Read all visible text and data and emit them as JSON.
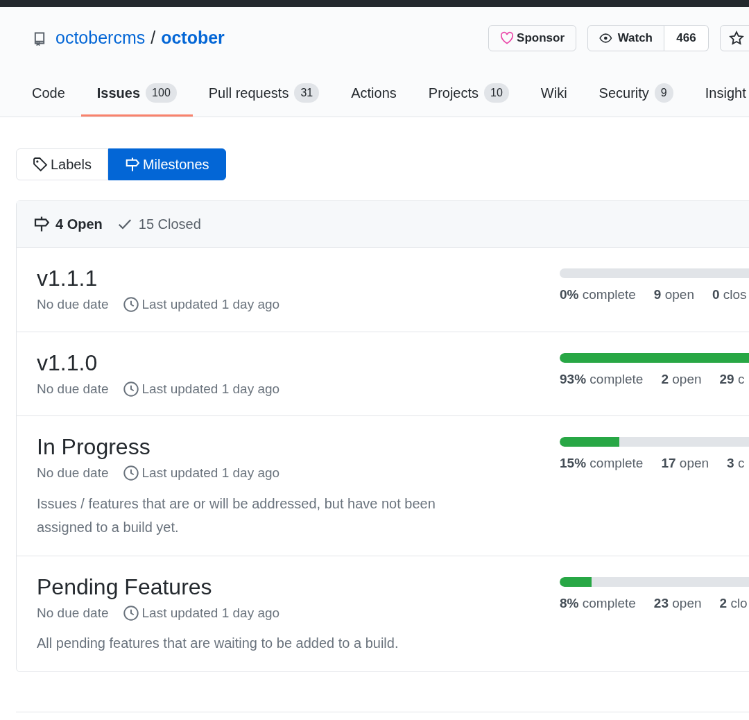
{
  "repo": {
    "owner": "octobercms",
    "separator": "/",
    "name": "october"
  },
  "header_buttons": [
    {
      "kind": "sponsor",
      "label": "Sponsor"
    },
    {
      "kind": "watch",
      "label": "Watch",
      "count": "466"
    },
    {
      "kind": "star"
    }
  ],
  "tabs": [
    {
      "label": "Code",
      "selected": false
    },
    {
      "label": "Issues",
      "count": "100",
      "selected": true
    },
    {
      "label": "Pull requests",
      "count": "31",
      "selected": false
    },
    {
      "label": "Actions",
      "selected": false
    },
    {
      "label": "Projects",
      "count": "10",
      "selected": false
    },
    {
      "label": "Wiki",
      "selected": false
    },
    {
      "label": "Security",
      "count": "9",
      "selected": false
    },
    {
      "label": "Insight",
      "selected": false
    }
  ],
  "subnav": [
    {
      "kind": "tag",
      "label": "Labels",
      "selected": false
    },
    {
      "kind": "milestone",
      "label": "Milestones",
      "selected": true
    }
  ],
  "states": [
    {
      "kind": "milestone",
      "count": "4",
      "label": "Open",
      "selected": true
    },
    {
      "kind": "check",
      "count": "15",
      "label": "Closed",
      "selected": false
    }
  ],
  "milestones": [
    {
      "title": "v1.1.1",
      "due": "No due date",
      "updated": "Last updated 1 day ago",
      "level": 0,
      "percent": "0%",
      "complete_label": "complete",
      "open_count": "9",
      "open_label": "open",
      "closed_count": "0",
      "closed_label": "clos"
    },
    {
      "title": "v1.1.0",
      "due": "No due date",
      "updated": "Last updated 1 day ago",
      "level": 0.93,
      "percent": "93%",
      "complete_label": "complete",
      "open_count": "2",
      "open_label": "open",
      "closed_count": "29",
      "closed_label": "c"
    },
    {
      "title": "In Progress",
      "due": "No due date",
      "updated": "Last updated 1 day ago",
      "description": "Issues / features that are or will be addressed, but have not been assigned to a build yet.",
      "level": 0.15,
      "percent": "15%",
      "complete_label": "complete",
      "open_count": "17",
      "open_label": "open",
      "closed_count": "3",
      "closed_label": "c"
    },
    {
      "title": "Pending Features",
      "due": "No due date",
      "updated": "Last updated 1 day ago",
      "description": "All pending features that are waiting to be added to a build.",
      "level": 0.08,
      "percent": "8%",
      "complete_label": "complete",
      "open_count": "23",
      "open_label": "open",
      "closed_count": "2",
      "closed_label": "clo"
    }
  ]
}
